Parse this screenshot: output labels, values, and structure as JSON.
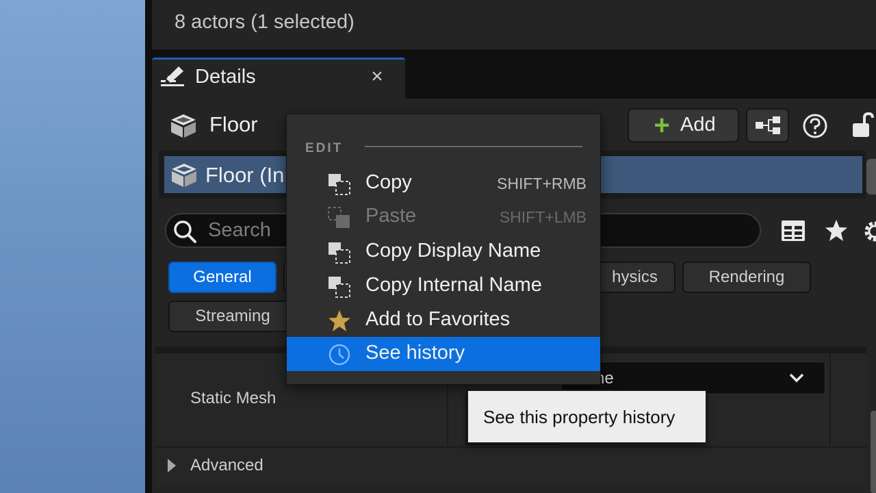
{
  "outliner": {
    "actors_count": "8 actors (1 selected)"
  },
  "details_tab": {
    "label": "Details",
    "close_glyph": "×"
  },
  "header": {
    "actor_name": "Floor",
    "add_label": "Add",
    "icons": [
      "actor-cube-icon",
      "add-plus-icon",
      "hierarchy-icon",
      "help-icon",
      "lock-icon"
    ]
  },
  "component": {
    "label": "Floor (In"
  },
  "search": {
    "placeholder": "Search"
  },
  "filters": {
    "general": "General",
    "physics": "hysics",
    "rendering": "Rendering",
    "streaming": "Streaming"
  },
  "property": {
    "static_mesh_label": "Static Mesh",
    "mesh_value": "ne",
    "advanced_label": "Advanced"
  },
  "context_menu": {
    "section": "EDIT",
    "items": [
      {
        "label": "Copy",
        "shortcut": "SHIFT+RMB",
        "icon": "copy-icon",
        "enabled": true
      },
      {
        "label": "Paste",
        "shortcut": "SHIFT+LMB",
        "icon": "paste-icon",
        "enabled": false
      },
      {
        "label": "Copy Display Name",
        "shortcut": "",
        "icon": "copy-icon",
        "enabled": true
      },
      {
        "label": "Copy Internal Name",
        "shortcut": "",
        "icon": "copy-icon",
        "enabled": true
      },
      {
        "label": "Add to Favorites",
        "shortcut": "",
        "icon": "star-icon",
        "enabled": true
      },
      {
        "label": "See history",
        "shortcut": "",
        "icon": "clock-icon",
        "enabled": true,
        "highlighted": true
      }
    ]
  },
  "tooltip": {
    "text": "See this property history"
  },
  "colors": {
    "accent_blue": "#0c6fe0",
    "selected_row": "#3d587a",
    "add_green": "#7ac140",
    "star_gold": "#c8a24a"
  }
}
